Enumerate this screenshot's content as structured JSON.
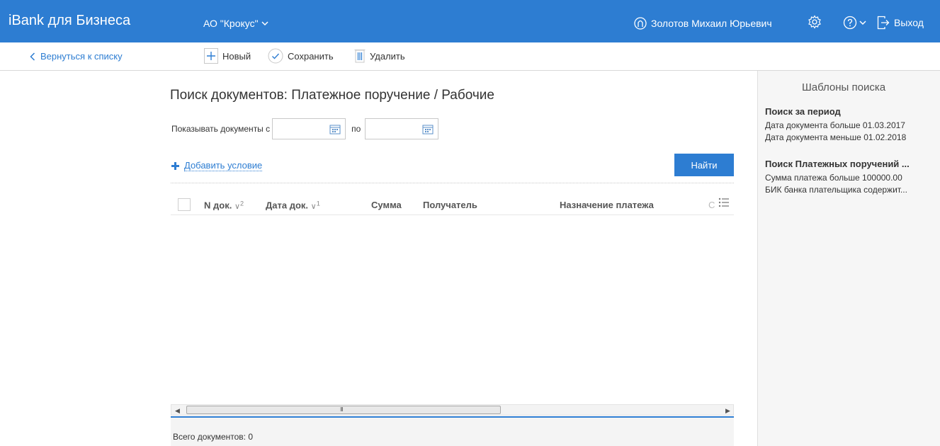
{
  "header": {
    "brand": "iBank для Бизнеса",
    "organization": "АО \"Крокус\"",
    "user_name": "Золотов Михаил Юрьевич",
    "logout_label": "Выход",
    "accent_color": "#2d7dd2"
  },
  "toolbar": {
    "back_label": "Вернуться к списку",
    "new_label": "Новый",
    "save_label": "Сохранить",
    "delete_label": "Удалить"
  },
  "search": {
    "title": "Поиск документов: Платежное поручение / Рабочие",
    "show_from_label": "Показывать документы с",
    "to_label": "по",
    "date_from_value": "",
    "date_to_value": "",
    "add_condition_label": "Добавить условие",
    "find_button_label": "Найти"
  },
  "table": {
    "columns": [
      {
        "label": "N док.",
        "sort": "2"
      },
      {
        "label": "Дата док.",
        "sort": "1"
      },
      {
        "label": "Сумма",
        "sort": ""
      },
      {
        "label": "Получатель",
        "sort": ""
      },
      {
        "label": "Назначение платежа",
        "sort": ""
      },
      {
        "label": "С",
        "sort": ""
      }
    ],
    "rows": [],
    "scroll_grip": "III"
  },
  "footer": {
    "total_label": "Всего документов: 0"
  },
  "templates_panel": {
    "title": "Шаблоны поиска",
    "templates": [
      {
        "name": "Поиск за период",
        "lines": [
          "Дата документа больше 01.03.2017",
          "Дата документа меньше 01.02.2018"
        ]
      },
      {
        "name": "Поиск Платежных поручений ...",
        "lines": [
          "Сумма платежа больше 100000.00",
          "БИК банка плательщика содержит..."
        ]
      }
    ]
  }
}
